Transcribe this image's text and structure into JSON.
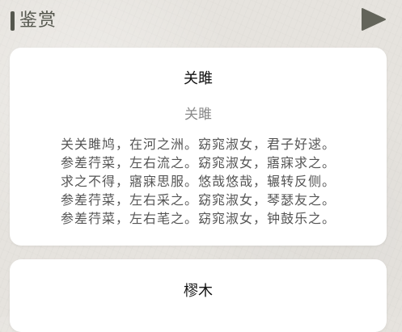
{
  "header": {
    "title": "鉴赏",
    "play_icon": "play-triangle-icon",
    "accent_color": "#55574e"
  },
  "cards": [
    {
      "title": "关雎",
      "author": "关雎",
      "lines": [
        "关关雎鸠，在河之洲。窈窕淑女，君子好逑。",
        "参差荇菜，左右流之。窈窕淑女，寤寐求之。",
        "求之不得，寤寐思服。悠哉悠哉，辗转反侧。",
        "参差荇菜，左右采之。窈窕淑女，琴瑟友之。",
        "参差荇菜，左右芼之。窈窕淑女，钟鼓乐之。"
      ]
    },
    {
      "title": "樛木"
    }
  ]
}
